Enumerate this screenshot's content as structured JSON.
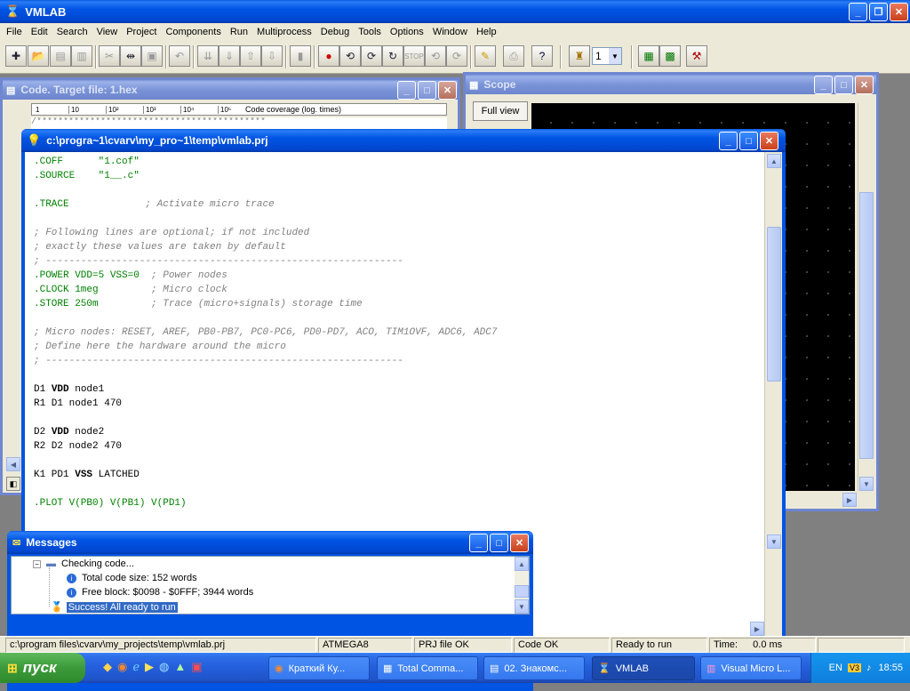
{
  "app": {
    "title": "VMLAB"
  },
  "menu": [
    "File",
    "Edit",
    "Search",
    "View",
    "Project",
    "Components",
    "Run",
    "Multiprocess",
    "Debug",
    "Tools",
    "Options",
    "Window",
    "Help"
  ],
  "toolbar": {
    "process_value": "1"
  },
  "code_window": {
    "title": "Code. Target file: 1.hex",
    "coverage_label": "Code coverage (log. times)",
    "ticks": [
      "1",
      "10",
      "10²",
      "10³",
      "10⁴",
      "10⁵"
    ]
  },
  "scope": {
    "title": "Scope",
    "full_view": "Full view"
  },
  "prj": {
    "title": "c:\\progra~1\\cvarv\\my_pro~1\\temp\\vmlab.prj",
    "lines": [
      [
        [
          ".COFF      \"1.cof\"",
          "g"
        ]
      ],
      [
        [
          ".SOURCE    \"1__.c\"",
          "g"
        ]
      ],
      [
        [
          "",
          ""
        ]
      ],
      [
        [
          ".TRACE",
          "g"
        ],
        [
          "             ; Activate micro trace",
          "c"
        ]
      ],
      [
        [
          "",
          ""
        ]
      ],
      [
        [
          "; Following lines are optional; if not included",
          "c"
        ]
      ],
      [
        [
          "; exactly these values are taken by default",
          "c"
        ]
      ],
      [
        [
          "; -------------------------------------------------------------",
          "c"
        ]
      ],
      [
        [
          ".POWER VDD=5 VSS=0",
          "g"
        ],
        [
          "  ; Power nodes",
          "c"
        ]
      ],
      [
        [
          ".CLOCK 1meg",
          "g"
        ],
        [
          "         ; Micro clock",
          "c"
        ]
      ],
      [
        [
          ".STORE 250m",
          "g"
        ],
        [
          "         ; Trace (micro+signals) storage time",
          "c"
        ]
      ],
      [
        [
          "",
          ""
        ]
      ],
      [
        [
          "; Micro nodes: RESET, AREF, PB0-PB7, PC0-PC6, PD0-PD7, ACO, TIM1OVF, ADC6, ADC7",
          "c"
        ]
      ],
      [
        [
          "; Define here the hardware around the micro",
          "c"
        ]
      ],
      [
        [
          "; -------------------------------------------------------------",
          "c"
        ]
      ],
      [
        [
          "",
          ""
        ]
      ],
      [
        [
          "D1 ",
          ""
        ],
        [
          "VDD",
          "b"
        ],
        [
          " node1",
          ""
        ]
      ],
      [
        [
          "R1 D1 node1 470",
          ""
        ]
      ],
      [
        [
          "",
          ""
        ]
      ],
      [
        [
          "D2 ",
          ""
        ],
        [
          "VDD",
          "b"
        ],
        [
          " node2",
          ""
        ]
      ],
      [
        [
          "R2 D2 node2 470",
          ""
        ]
      ],
      [
        [
          "",
          ""
        ]
      ],
      [
        [
          "K1 PD1 ",
          ""
        ],
        [
          "VSS",
          "b"
        ],
        [
          " LATCHED",
          ""
        ]
      ],
      [
        [
          "",
          ""
        ]
      ],
      [
        [
          ".PLOT V(PB0) V(PB1) V(PD1)",
          "g"
        ]
      ]
    ]
  },
  "messages": {
    "title": "Messages",
    "checking": "Checking code...",
    "total_size": "Total code size: 152 words",
    "free_block": "Free block: $0098 - $0FFF; 3944 words",
    "success": "Success! All ready to run"
  },
  "status": {
    "path": "c:\\program files\\cvarv\\my_projects\\temp\\vmlab.prj",
    "device": "ATMEGA8",
    "prj_status": "PRJ file OK",
    "code_status": "Code OK",
    "run_status": "Ready to run",
    "time_label": "Time:",
    "time_value": "0.0 ms"
  },
  "taskbar": {
    "start": "пуск",
    "tasks": [
      "Краткий Ку...",
      "Total Comma...",
      "02. Знакомс...",
      "VMLAB",
      "Visual Micro L..."
    ],
    "lang": "EN",
    "clock": "18:55"
  },
  "colors": {
    "title_active": "#0054e3",
    "title_inactive": "#7a94d8",
    "code_green": "#008000",
    "comment_gray": "#808080",
    "selection": "#316ac5"
  }
}
